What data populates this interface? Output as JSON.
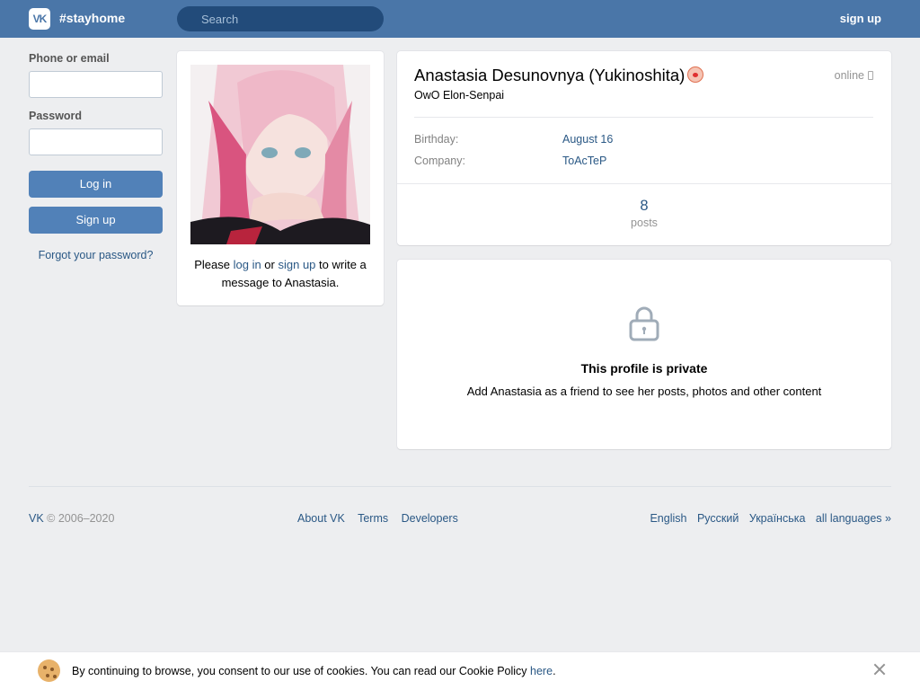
{
  "header": {
    "logo": "VK",
    "brand": "#stayhome",
    "search_placeholder": "Search",
    "signup": "sign up"
  },
  "login": {
    "phone_label": "Phone or email",
    "password_label": "Password",
    "login_button": "Log in",
    "signup_button": "Sign up",
    "forgot": "Forgot your password?"
  },
  "photo_card": {
    "note_prefix": "Please ",
    "login_link": "log in",
    "note_or": " or ",
    "signup_link": "sign up",
    "note_suffix": " to write a message to Anastasia."
  },
  "profile": {
    "name": "Anastasia Desunovnya (Yukinoshita)",
    "status": "OwO Elon-Senpai",
    "online": "online",
    "birthday_label": "Birthday:",
    "birthday_value": "August 16",
    "company_label": "Company:",
    "company_value": "ToAcTeP",
    "posts_count": "8",
    "posts_label": "posts"
  },
  "private": {
    "title": "This profile is private",
    "text": "Add Anastasia as a friend to see her posts, photos and other content"
  },
  "footer": {
    "copyright_brand": "VK",
    "copyright": " © 2006–2020",
    "links": [
      "About VK",
      "Terms",
      "Developers"
    ],
    "languages": [
      "English",
      "Русский",
      "Українська",
      "all languages »"
    ]
  },
  "cookie": {
    "text": "By continuing to browse, you consent to our use of cookies. You can read our Cookie Policy ",
    "link": "here",
    "end": "."
  },
  "colors": {
    "header": "#4a76a8",
    "button": "#5181b8",
    "link": "#2a5885",
    "background": "#edeef0"
  }
}
